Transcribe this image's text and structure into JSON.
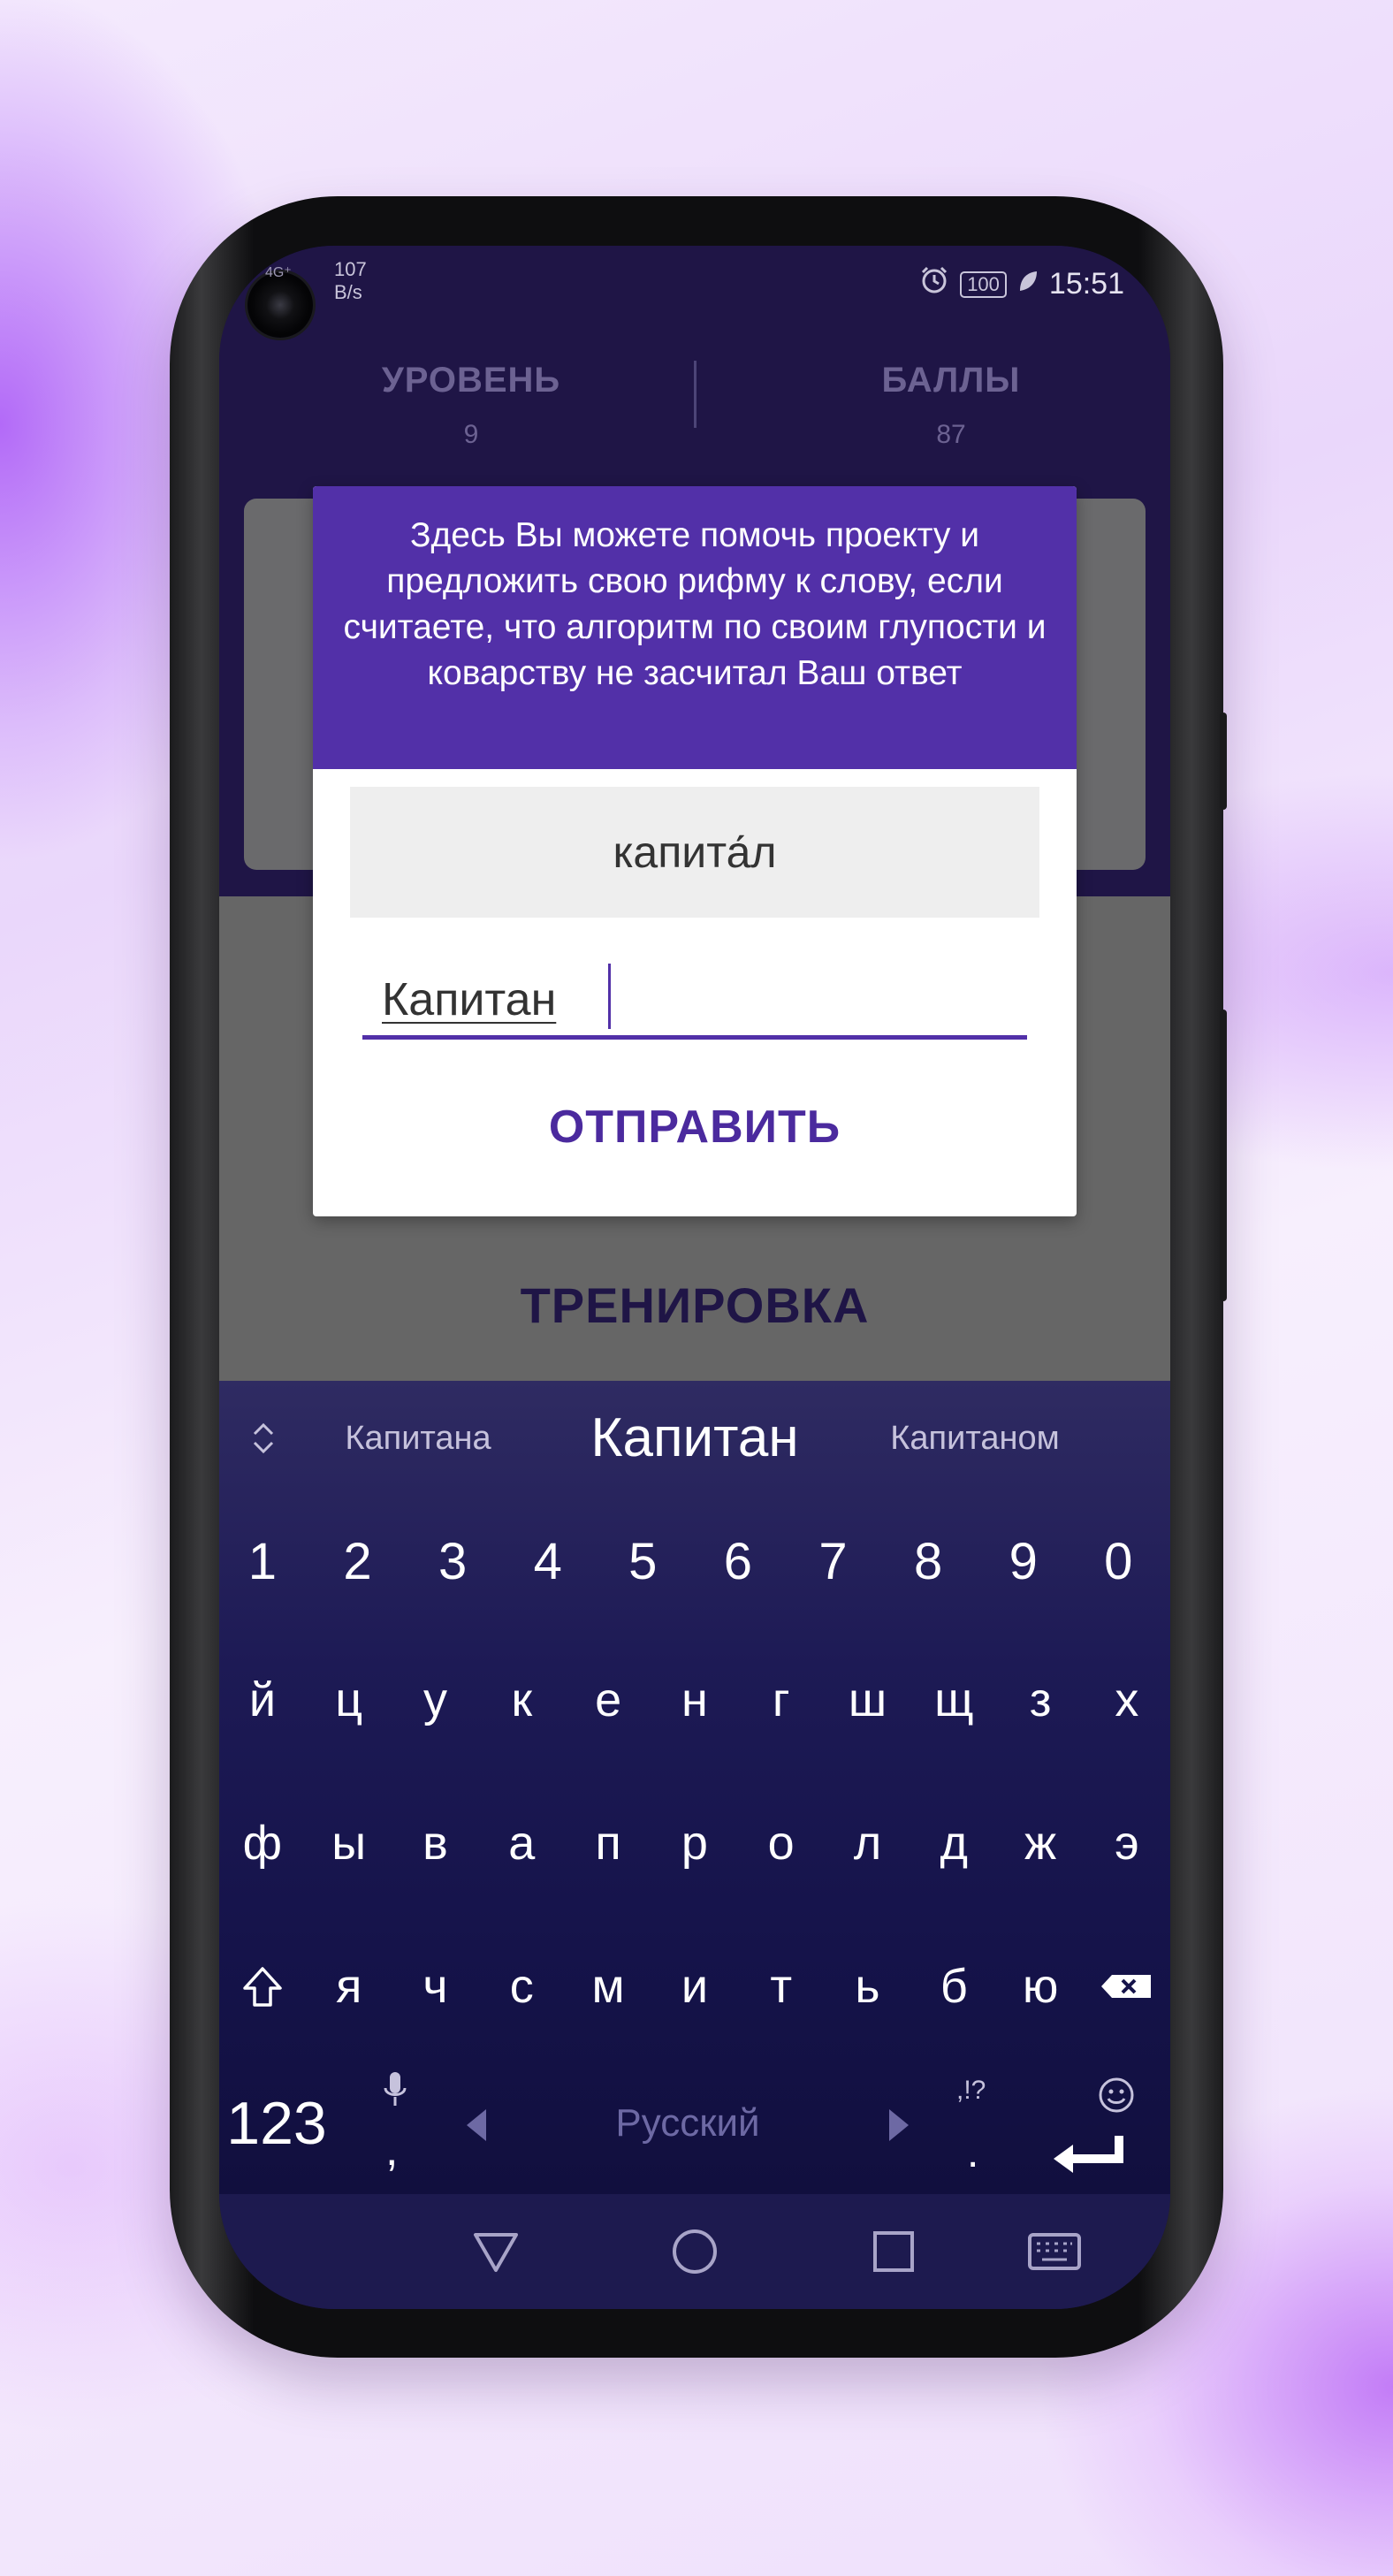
{
  "status_bar": {
    "network_type": "4G⁺",
    "network_speed_value": "107",
    "network_speed_unit": "B/s",
    "battery": "100",
    "time": "15:51"
  },
  "stats": {
    "level_label": "УРОВЕНЬ",
    "level_value": "9",
    "score_label": "БАЛЛЫ",
    "score_value": "87"
  },
  "dialog": {
    "message": "Здесь Вы можете помочь проекту и предложить свою рифму к слову, если считаете, что алгоритм по своим глупости и коварству не засчитал Ваш ответ",
    "word": "капита́л",
    "input_value": "Капитан",
    "submit_label": "ОТПРАВИТЬ"
  },
  "training_label": "ТРЕНИРОВКА",
  "keyboard": {
    "suggestions": [
      "Капитана",
      "Капитан",
      "Капитаном"
    ],
    "number_row": [
      "1",
      "2",
      "3",
      "4",
      "5",
      "6",
      "7",
      "8",
      "9",
      "0"
    ],
    "row1": [
      "й",
      "ц",
      "у",
      "к",
      "е",
      "н",
      "г",
      "ш",
      "щ",
      "з",
      "х"
    ],
    "row2": [
      "ф",
      "ы",
      "в",
      "а",
      "п",
      "р",
      "о",
      "л",
      "д",
      "ж",
      "э"
    ],
    "row3": [
      "я",
      "ч",
      "с",
      "м",
      "и",
      "т",
      "ь",
      "б",
      "ю"
    ],
    "symbols_key": "123",
    "comma": ",",
    "space_label": "Русский",
    "period_alt": ",!?",
    "period": "."
  },
  "colors": {
    "accent": "#5230a8",
    "app_background": "#1f1546",
    "dim_overlay": "#666666"
  }
}
